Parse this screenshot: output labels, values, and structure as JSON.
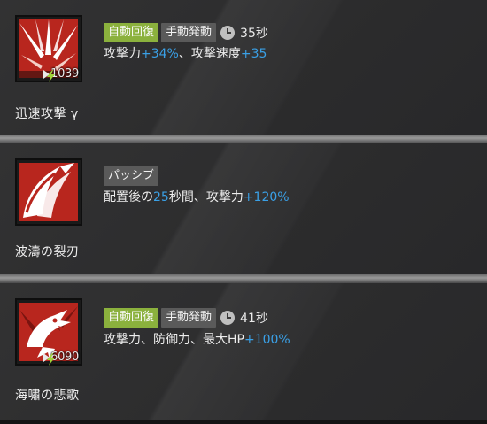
{
  "skills": [
    {
      "name": "迅速攻撃 γ",
      "icon": "slash-burst-icon",
      "cost_initial": "10",
      "cost_sp": "39",
      "tags": [
        "自動回復",
        "手動発動"
      ],
      "duration": "35秒",
      "desc_parts": [
        "攻撃力",
        "+34%",
        "、攻撃速度",
        "+35"
      ]
    },
    {
      "name": "波濤の裂刃",
      "icon": "blade-wave-icon",
      "tags": [
        "パッシブ"
      ],
      "desc_parts": [
        "配置後の",
        "25",
        "秒間、攻撃力",
        "+120%"
      ]
    },
    {
      "name": "海嘯の悲歌",
      "icon": "roaring-beast-icon",
      "cost_initial": "60",
      "cost_sp": "90",
      "tags": [
        "自動回復",
        "手動発動"
      ],
      "duration": "41秒",
      "desc_parts": [
        "攻撃力、防御力、最大HP",
        "+100%"
      ]
    }
  ],
  "colors": {
    "tag_green": "#8bb13d",
    "tag_grey": "#5a5a5a",
    "highlight_blue": "#3aa0e6",
    "icon_red": "#b8261e"
  }
}
